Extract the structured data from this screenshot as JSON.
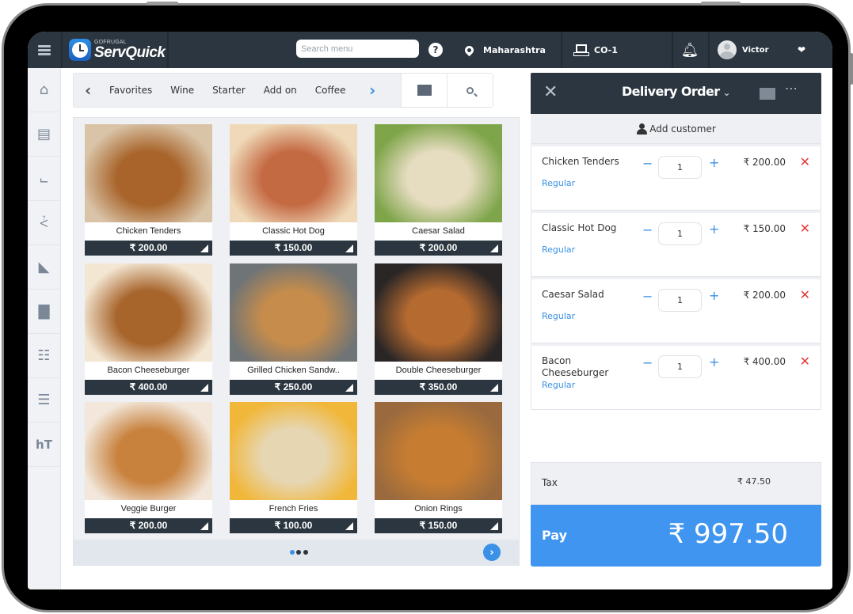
{
  "app": {
    "brand_sub": "GOFRUGAL",
    "brand_name": "ServQuick"
  },
  "topbar": {
    "search_placeholder": "Search menu",
    "help_label": "?",
    "location": "Maharashtra",
    "counter": "CO-1",
    "user_name": "Victor"
  },
  "sidebar": {
    "items": [
      {
        "icon": "home-icon"
      },
      {
        "icon": "menu-catalog-icon"
      },
      {
        "icon": "delivery-trolley-icon"
      },
      {
        "icon": "cart-icon"
      },
      {
        "icon": "kitchen-icon"
      },
      {
        "icon": "reports-icon"
      },
      {
        "icon": "orders-clipboard-icon"
      },
      {
        "icon": "settings-sliders-icon"
      },
      {
        "icon": "table-icon"
      }
    ]
  },
  "categories": {
    "items": [
      "Favorites",
      "Wine",
      "Starter",
      "Add on",
      "Coffee"
    ]
  },
  "menu_items": [
    {
      "name": "Chicken Tenders",
      "price": "₹ 200.00",
      "colors": [
        "#d9c4a8",
        "#a8642a"
      ]
    },
    {
      "name": "Classic Hot Dog",
      "price": "₹ 150.00",
      "colors": [
        "#efd9b8",
        "#c46a43"
      ]
    },
    {
      "name": "Caesar Salad",
      "price": "₹ 200.00",
      "colors": [
        "#7fa54a",
        "#e6dcc0"
      ]
    },
    {
      "name": "Bacon Cheeseburger",
      "price": "₹ 400.00",
      "colors": [
        "#f3e6d2",
        "#a7642b"
      ]
    },
    {
      "name": "Grilled Chicken Sandw..",
      "price": "₹ 250.00",
      "colors": [
        "#6f7476",
        "#c58c4c"
      ]
    },
    {
      "name": "Double Cheeseburger",
      "price": "₹ 350.00",
      "colors": [
        "#2a2626",
        "#b56a30"
      ]
    },
    {
      "name": "Veggie Burger",
      "price": "₹ 200.00",
      "colors": [
        "#f2e7da",
        "#c8823e"
      ]
    },
    {
      "name": "French Fries",
      "price": "₹ 100.00",
      "colors": [
        "#f1b73a",
        "#e6d6b2"
      ]
    },
    {
      "name": "Onion Rings",
      "price": "₹ 150.00",
      "colors": [
        "#9a6a3e",
        "#c77d31"
      ]
    }
  ],
  "pager": {
    "pages": 3,
    "current": 1
  },
  "order": {
    "title": "Delivery Order",
    "add_customer": "Add customer",
    "lines": [
      {
        "name": "Chicken Tenders",
        "variant": "Regular",
        "qty": "1",
        "price": "₹ 200.00"
      },
      {
        "name": "Classic Hot Dog",
        "variant": "Regular",
        "qty": "1",
        "price": "₹ 150.00"
      },
      {
        "name": "Caesar Salad",
        "variant": "Regular",
        "qty": "1",
        "price": "₹ 200.00"
      },
      {
        "name": "Bacon Cheeseburger",
        "variant": "Regular",
        "qty": "1",
        "price": "₹ 400.00"
      }
    ],
    "tax_label": "Tax",
    "tax_value": "₹ 47.50",
    "pay_label": "Pay",
    "pay_total": "₹ 997.50"
  },
  "colors": {
    "topbar": "#2b3640",
    "accent": "#3a91e6",
    "pay": "#3f95ef",
    "delete": "#e03c3c"
  }
}
